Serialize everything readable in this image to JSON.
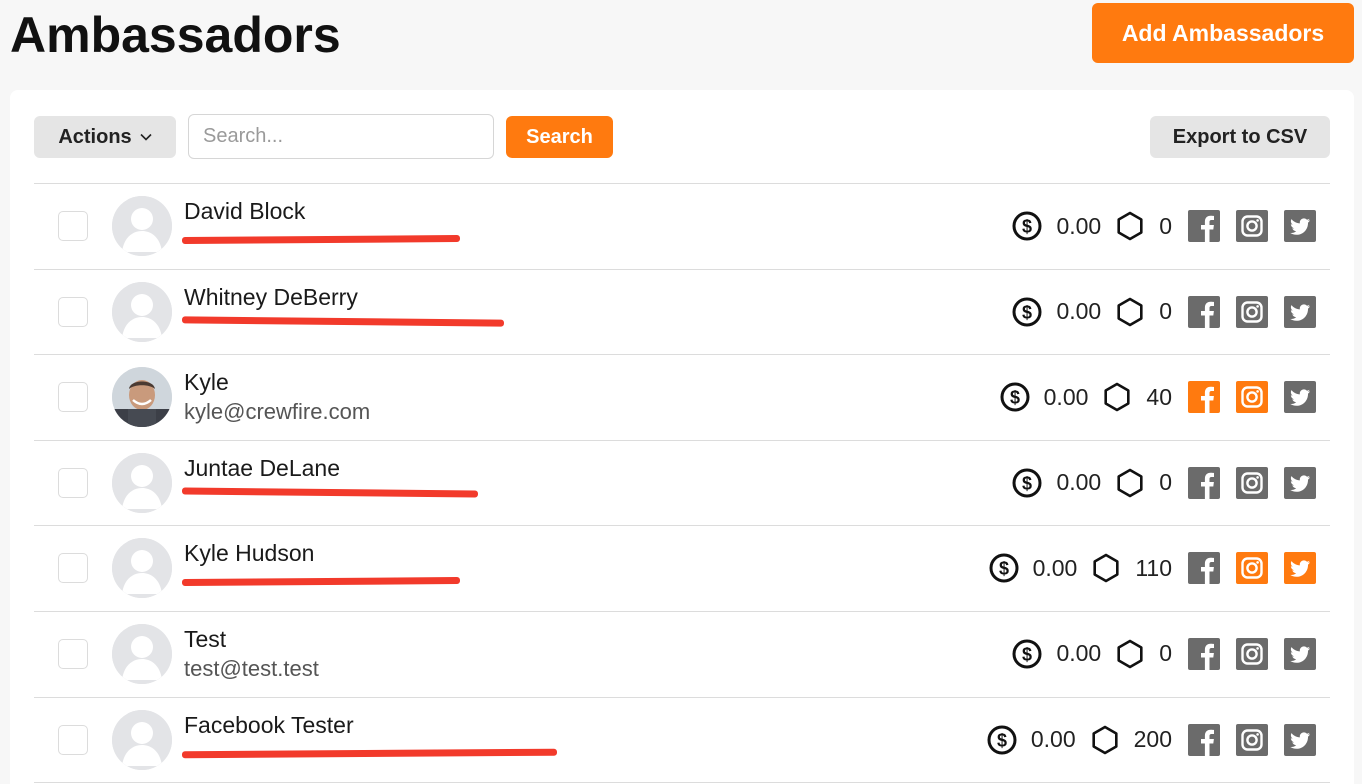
{
  "page": {
    "title": "Ambassadors"
  },
  "header": {
    "add_label": "Add Ambassadors"
  },
  "toolbar": {
    "actions_label": "Actions",
    "search_placeholder": "Search...",
    "search_label": "Search",
    "export_label": "Export to CSV"
  },
  "colors": {
    "accent": "#ff7a0f",
    "inactive_social": "#6b6b6b",
    "redaction": "#f23a2b"
  },
  "ambassadors": [
    {
      "name": "David Block",
      "email": "",
      "email_redacted": true,
      "money": "0.00",
      "points": "0",
      "facebook": false,
      "instagram": false,
      "twitter": false,
      "avatar": "default"
    },
    {
      "name": "Whitney DeBerry",
      "email": "",
      "email_redacted": true,
      "money": "0.00",
      "points": "0",
      "facebook": false,
      "instagram": false,
      "twitter": false,
      "avatar": "default"
    },
    {
      "name": "Kyle",
      "email": "kyle@crewfire.com",
      "email_redacted": false,
      "money": "0.00",
      "points": "40",
      "facebook": true,
      "instagram": true,
      "twitter": false,
      "avatar": "photo"
    },
    {
      "name": "Juntae DeLane",
      "email": "",
      "email_redacted": true,
      "money": "0.00",
      "points": "0",
      "facebook": false,
      "instagram": false,
      "twitter": false,
      "avatar": "default"
    },
    {
      "name": "Kyle Hudson",
      "email": "",
      "email_redacted": true,
      "money": "0.00",
      "points": "110",
      "facebook": false,
      "instagram": true,
      "twitter": true,
      "avatar": "default"
    },
    {
      "name": "Test",
      "email": "test@test.test",
      "email_redacted": false,
      "money": "0.00",
      "points": "0",
      "facebook": false,
      "instagram": false,
      "twitter": false,
      "avatar": "default"
    },
    {
      "name": "Facebook Tester",
      "email": "",
      "email_redacted": true,
      "money": "0.00",
      "points": "200",
      "facebook": false,
      "instagram": false,
      "twitter": false,
      "avatar": "default"
    }
  ]
}
